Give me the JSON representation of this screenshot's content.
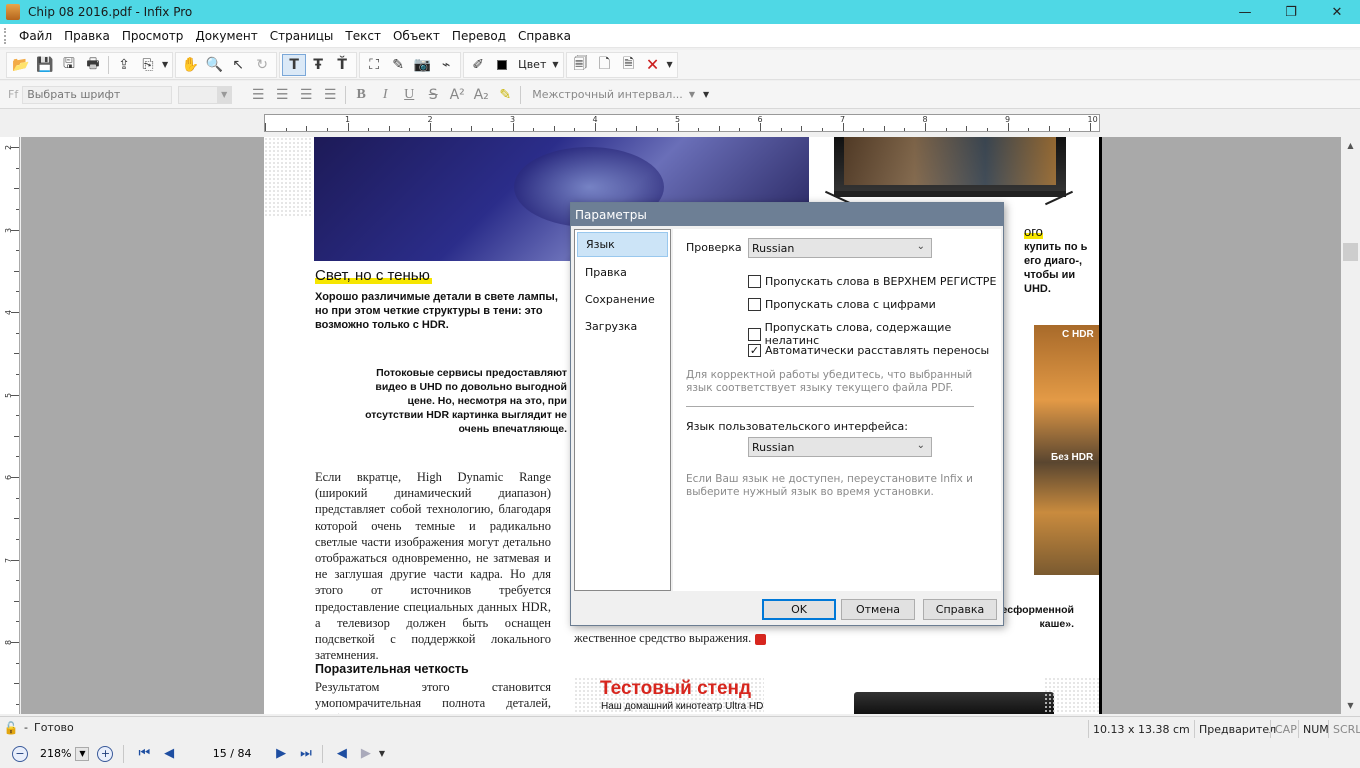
{
  "window": {
    "title": "Chip 08 2016.pdf - Infix Pro",
    "minimize": "—",
    "maximize": "❐",
    "close": "✕"
  },
  "menu": [
    "Файл",
    "Правка",
    "Просмотр",
    "Документ",
    "Страницы",
    "Текст",
    "Объект",
    "Перевод",
    "Справка"
  ],
  "toolbar": {
    "color_label": "Цвет",
    "font_placeholder": "Выбрать шрифт",
    "line_spacing": "Межстрочный интервал...",
    "icons": [
      "open-icon",
      "save-icon",
      "save-as-icon",
      "print-icon",
      "export-icon",
      "import-icon",
      "hand-icon",
      "zoom-icon",
      "select-arrow-icon",
      "rotate-icon",
      "text-tool-icon",
      "text-edit-icon",
      "text-flow-icon",
      "crop-icon",
      "pen-icon",
      "camera-icon",
      "link-icon",
      "eyedropper-icon",
      "color-swatch-icon",
      "page-icon-1",
      "page-icon-2",
      "page-icon-3",
      "page-delete-icon"
    ]
  },
  "ruler": {
    "h_labels": [
      "1",
      "2",
      "3",
      "4",
      "5",
      "6",
      "7",
      "8",
      "9",
      "10"
    ],
    "v_labels": [
      "2",
      "3",
      "4",
      "5",
      "6",
      "7",
      "8"
    ]
  },
  "page": {
    "heading": "Свет, но с тенью",
    "lede": "Хорошо различимые детали в свете лампы, но при этом четкие структуры в тени: это возможно только с HDR.",
    "quote": "Потоковые сервисы предоставляют видео в UHD по довольно выгодной цене. Но, несмотря на это, при отсутствии HDR картинка выглядит не очень впечатляюще.",
    "body": "Если вкратце, High Dynamic Range (широкий динамический диапазон) представляет собой технологию, благодаря которой очень темные и радикально светлые части изображения могут детально отображаться одновременно, не затмевая и не заглушая другие части кадра. Но для этого от источников требуется предоставление специальных данных HDR, а телевизор должен быть оснащен подсветкой с поддержкой локального затемнения.",
    "subhead": "Поразительная четкость",
    "body2": "Результатом этого становится умопомрачительная полнота деталей, особенно в",
    "mid_cont": "жественное средство выражения.",
    "test_title": "Тестовый стенд",
    "test_sub": "Наш домашний кинотеатр Ultra HD",
    "right_heading": "ого",
    "right_lines": "купить по ь его диаго-, чтобы ии UHD.",
    "label_hdr": "С HDR",
    "label_nohdr": "Без HDR",
    "caption_right": "ктиве каме- ... HDR тонет в «бесформенной каше»."
  },
  "dialog": {
    "title": "Параметры",
    "nav": [
      "Язык",
      "Правка",
      "Сохранение",
      "Загрузка"
    ],
    "check_label": "Проверка",
    "check_value": "Russian",
    "options": [
      {
        "label": "Пропускать слова в ВЕРХНЕМ РЕГИСТРЕ",
        "checked": false
      },
      {
        "label": "Пропускать слова с цифрами",
        "checked": false
      },
      {
        "label": "Пропускать слова, содержащие нелатинс",
        "checked": false
      },
      {
        "label": "Автоматически расставлять переносы",
        "checked": true
      }
    ],
    "hint1": "Для корректной работы убедитесь, что выбранный язык соответствует языку текущего файла PDF.",
    "ui_lang_label": "Язык пользовательского интерфейса:",
    "ui_lang_value": "Russian",
    "hint2": "Если Ваш язык не доступен, переустановите Infix и выберите нужный язык во время установки.",
    "ok": "OK",
    "cancel": "Отмена",
    "help": "Справка"
  },
  "status": {
    "text": "Готово",
    "dash": "-",
    "dimensions": "10.13 x 13.38 cm",
    "preview": "Предварител",
    "cap": "CAP",
    "num": "NUM",
    "scrl": "SCRL"
  },
  "nav": {
    "zoom": "218%",
    "page": "15 / 84"
  }
}
